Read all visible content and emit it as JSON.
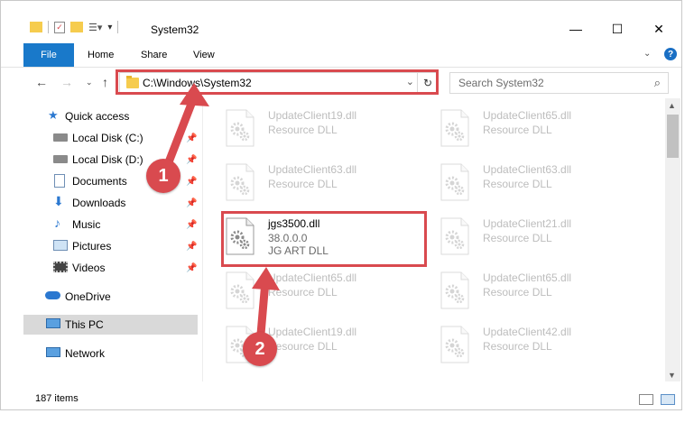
{
  "window": {
    "title": "System32",
    "controls": {
      "minimize": "—",
      "maximize": "☐",
      "close": "✕"
    }
  },
  "ribbon": {
    "tabs": [
      {
        "label": "File"
      },
      {
        "label": "Home"
      },
      {
        "label": "Share"
      },
      {
        "label": "View"
      }
    ],
    "help_label": "?"
  },
  "address_bar": {
    "path": "C:\\Windows\\System32",
    "dropdown": "⌄",
    "refresh": "↻"
  },
  "search": {
    "placeholder": "Search System32"
  },
  "sidebar": {
    "items": [
      {
        "label": "Quick access",
        "icon": "star-icon",
        "pinned": false
      },
      {
        "label": "Local Disk (C:)",
        "icon": "drive-icon",
        "pinned": true
      },
      {
        "label": "Local Disk (D:)",
        "icon": "drive-icon",
        "pinned": true
      },
      {
        "label": "Documents",
        "icon": "documents-icon",
        "pinned": true
      },
      {
        "label": "Downloads",
        "icon": "download-icon",
        "pinned": true
      },
      {
        "label": "Music",
        "icon": "music-icon",
        "pinned": true
      },
      {
        "label": "Pictures",
        "icon": "pictures-icon",
        "pinned": true
      },
      {
        "label": "Videos",
        "icon": "videos-icon",
        "pinned": true
      },
      {
        "label": "OneDrive",
        "icon": "cloud-icon",
        "pinned": false
      },
      {
        "label": "This PC",
        "icon": "computer-icon",
        "pinned": false,
        "selected": true
      },
      {
        "label": "Network",
        "icon": "network-icon",
        "pinned": false
      }
    ]
  },
  "files": {
    "left_column": [
      {
        "name": "UpdateClient19.dll",
        "type": "Resource DLL"
      },
      {
        "name": "UpdateClient63.dll",
        "type": "Resource DLL"
      },
      {
        "name": "jgs3500.dll",
        "version": "38.0.0.0",
        "type": "JG ART DLL",
        "highlighted": true
      },
      {
        "name": "UpdateClient65.dll",
        "type": "Resource DLL"
      },
      {
        "name": "UpdateClient19.dll",
        "type": "Resource DLL"
      }
    ],
    "right_column": [
      {
        "name": "UpdateClient65.dll",
        "type": "Resource DLL"
      },
      {
        "name": "UpdateClient63.dll",
        "type": "Resource DLL"
      },
      {
        "name": "UpdateClient21.dll",
        "type": "Resource DLL"
      },
      {
        "name": "UpdateClient65.dll",
        "type": "Resource DLL"
      },
      {
        "name": "UpdateClient42.dll",
        "type": "Resource DLL"
      }
    ]
  },
  "status_bar": {
    "item_count": "187 items"
  },
  "annotations": {
    "step1": "1",
    "step2": "2",
    "color": "#d94a4f"
  }
}
